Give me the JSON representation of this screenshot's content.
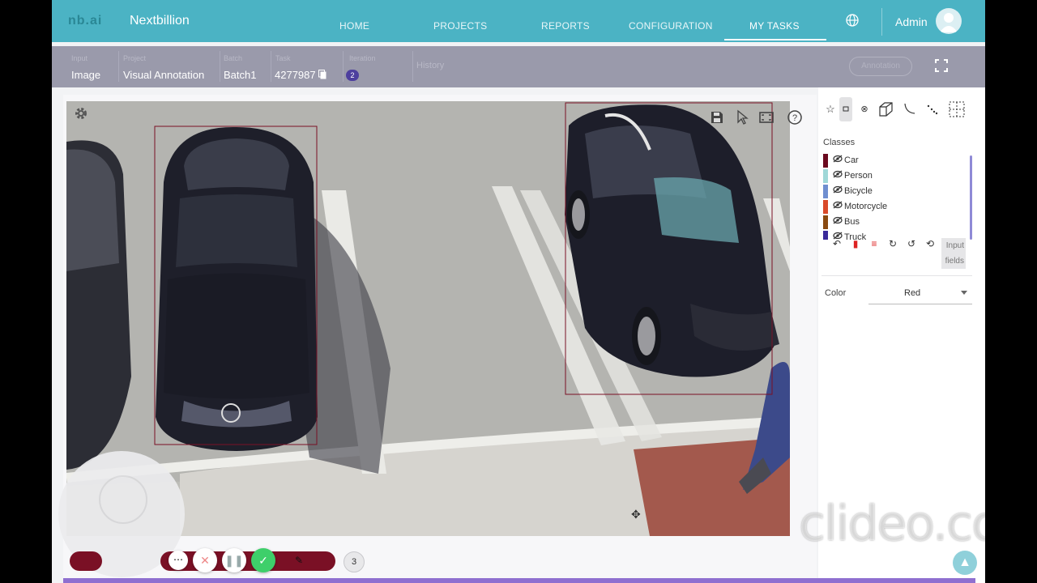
{
  "nav": {
    "logo": "nb.ai",
    "brand": "Nextbillion",
    "items": [
      "HOME",
      "PROJECTS",
      "REPORTS",
      "CONFIGURATION",
      "MY TASKS"
    ],
    "active": "MY TASKS",
    "user": "Admin"
  },
  "info": {
    "fields": [
      {
        "label": "Input",
        "value": "Image"
      },
      {
        "label": "Project",
        "value": "Visual Annotation"
      },
      {
        "label": "Batch",
        "value": "Batch1"
      },
      {
        "label": "Task",
        "value": "4277987"
      },
      {
        "label": "Iteration",
        "value": "2"
      },
      {
        "label": "History",
        "value": ""
      }
    ],
    "status": "Annotation"
  },
  "tools": [
    "star-icon",
    "rectangle-icon",
    "circle-icon",
    "cuboid-icon",
    "polyline-icon",
    "points-icon",
    "grid-icon"
  ],
  "canvas_tools": [
    "save-icon",
    "pointer-icon",
    "fit-screen-icon",
    "help-icon"
  ],
  "panel": {
    "classes_title": "Classes",
    "classes": [
      {
        "name": "Car",
        "color": "#6b0a1f"
      },
      {
        "name": "Person",
        "color": "#9fd8d8"
      },
      {
        "name": "Bicycle",
        "color": "#6f8fd0"
      },
      {
        "name": "Motorcycle",
        "color": "#d94a2a"
      },
      {
        "name": "Bus",
        "color": "#8a4a10"
      },
      {
        "name": "Truck",
        "color": "#3a2a9a"
      }
    ],
    "input_fields_label": "Input fields",
    "color_label": "Color",
    "color_value": "Red"
  },
  "annotation_count": "3",
  "watermark": "clideo.com"
}
